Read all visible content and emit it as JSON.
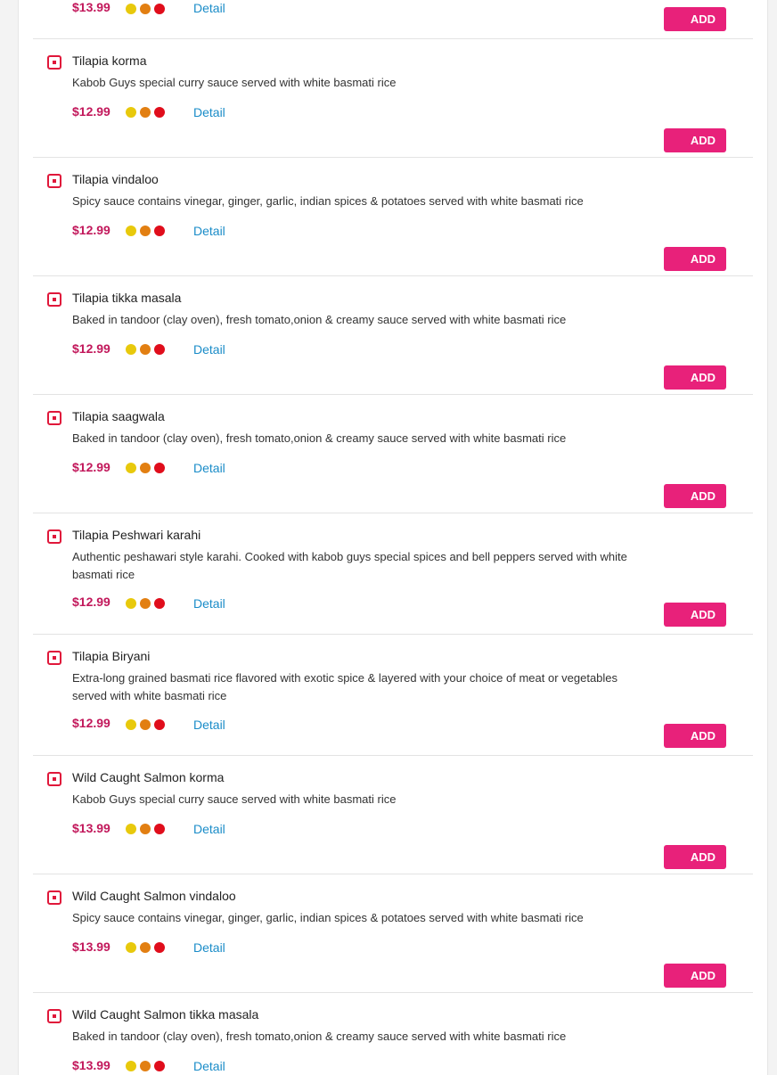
{
  "colors": {
    "price": "#c2185b",
    "add_button": "#e8217a",
    "detail_link": "#1a8cc8",
    "veg_mark": "#e0173a",
    "spice_levels": [
      "#e8c90c",
      "#e27f12",
      "#e00d1b"
    ]
  },
  "labels": {
    "detail": "Detail",
    "add": "ADD"
  },
  "items": [
    {
      "name": "",
      "description": "",
      "price": "$13.99"
    },
    {
      "name": "Tilapia korma",
      "description": "Kabob Guys special curry sauce served with white basmati rice",
      "price": "$12.99"
    },
    {
      "name": "Tilapia vindaloo",
      "description": "Spicy sauce contains vinegar, ginger, garlic, indian spices & potatoes served with white basmati rice",
      "price": "$12.99"
    },
    {
      "name": "Tilapia tikka masala",
      "description": "Baked in tandoor (clay oven), fresh tomato,onion & creamy sauce served with white basmati rice",
      "price": "$12.99"
    },
    {
      "name": "Tilapia saagwala",
      "description": "Baked in tandoor (clay oven), fresh tomato,onion & creamy sauce served with white basmati rice",
      "price": "$12.99"
    },
    {
      "name": "Tilapia Peshwari karahi",
      "description": "Authentic peshawari style karahi. Cooked with kabob guys special spices and bell peppers served with white basmati rice",
      "price": "$12.99"
    },
    {
      "name": "Tilapia Biryani",
      "description": "Extra-long grained basmati rice flavored with exotic spice & layered with your choice of meat or vegetables served with white basmati rice",
      "price": "$12.99"
    },
    {
      "name": "Wild Caught Salmon korma",
      "description": "Kabob Guys special curry sauce served with white basmati rice",
      "price": "$13.99"
    },
    {
      "name": "Wild Caught Salmon vindaloo",
      "description": "Spicy sauce contains vinegar, ginger, garlic, indian spices & potatoes served with white basmati rice",
      "price": "$13.99"
    },
    {
      "name": "Wild Caught Salmon tikka masala",
      "description": "Baked in tandoor (clay oven), fresh tomato,onion & creamy sauce served with white basmati rice",
      "price": "$13.99"
    }
  ]
}
